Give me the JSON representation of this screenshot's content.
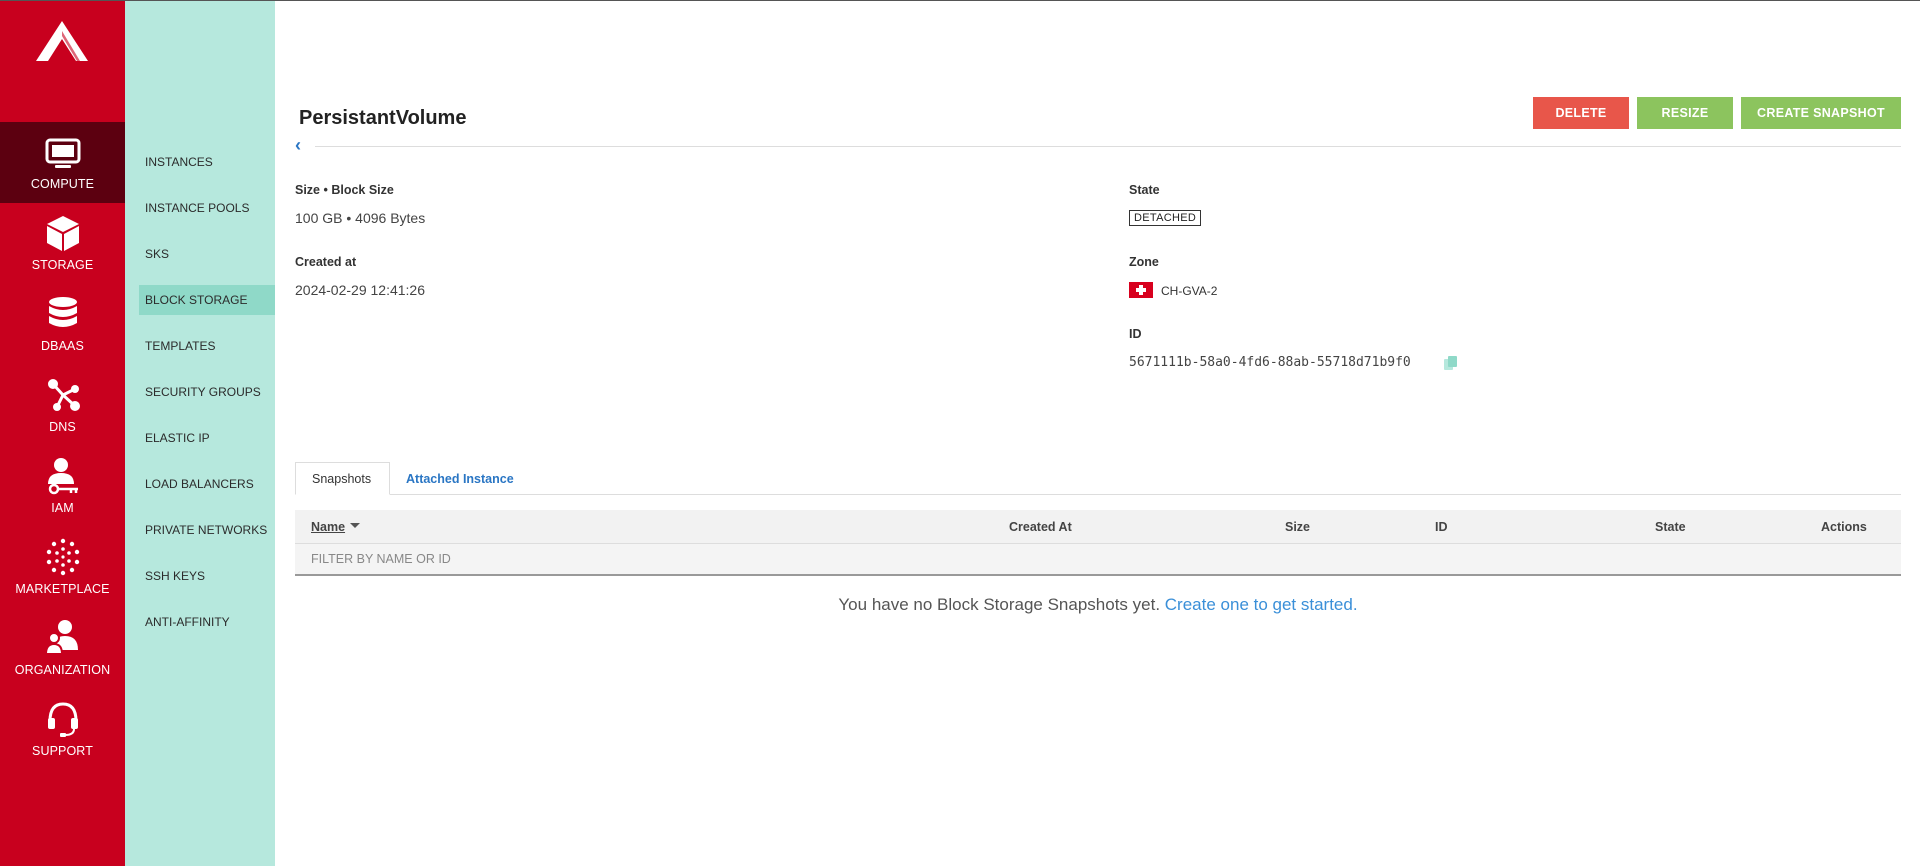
{
  "primary_nav": [
    {
      "label": "COMPUTE",
      "icon": "monitor-icon",
      "active": true
    },
    {
      "label": "STORAGE",
      "icon": "cube-icon",
      "active": false
    },
    {
      "label": "DBAAS",
      "icon": "database-icon",
      "active": false
    },
    {
      "label": "DNS",
      "icon": "dns-nodes-icon",
      "active": false
    },
    {
      "label": "IAM",
      "icon": "user-key-icon",
      "active": false
    },
    {
      "label": "MARKETPLACE",
      "icon": "marketplace-dots-icon",
      "active": false
    },
    {
      "label": "ORGANIZATION",
      "icon": "organization-icon",
      "active": false
    },
    {
      "label": "SUPPORT",
      "icon": "headset-icon",
      "active": false
    }
  ],
  "secondary_nav": [
    {
      "label": "INSTANCES",
      "active": false
    },
    {
      "label": "INSTANCE POOLS",
      "active": false
    },
    {
      "label": "SKS",
      "active": false
    },
    {
      "label": "BLOCK STORAGE",
      "active": true
    },
    {
      "label": "TEMPLATES",
      "active": false
    },
    {
      "label": "SECURITY GROUPS",
      "active": false
    },
    {
      "label": "ELASTIC IP",
      "active": false
    },
    {
      "label": "LOAD BALANCERS",
      "active": false
    },
    {
      "label": "PRIVATE NETWORKS",
      "active": false
    },
    {
      "label": "SSH KEYS",
      "active": false
    },
    {
      "label": "ANTI-AFFINITY",
      "active": false
    }
  ],
  "page": {
    "title": "PersistantVolume",
    "buttons": {
      "delete": "DELETE",
      "resize": "RESIZE",
      "create_snapshot": "CREATE SNAPSHOT"
    }
  },
  "details": {
    "size_label": "Size • Block Size",
    "size_value": "100 GB • 4096 Bytes",
    "created_label": "Created at",
    "created_value": "2024-02-29 12:41:26",
    "state_label": "State",
    "state_value": "DETACHED",
    "zone_label": "Zone",
    "zone_value": "CH-GVA-2",
    "id_label": "ID",
    "id_value": "5671111b-58a0-4fd6-88ab-55718d71b9f0"
  },
  "tabs": [
    {
      "label": "Snapshots",
      "active": true
    },
    {
      "label": "Attached Instance",
      "active": false
    }
  ],
  "table": {
    "columns": {
      "name": "Name",
      "created_at": "Created At",
      "size": "Size",
      "id": "ID",
      "state": "State",
      "actions": "Actions"
    },
    "filter_placeholder": "FILTER BY NAME OR ID",
    "empty_text": "You have no Block Storage Snapshots yet.",
    "empty_link": "Create one to get started",
    "empty_suffix": "."
  },
  "colors": {
    "primary_sidebar": "#c8001e",
    "primary_active": "#5c0010",
    "secondary_sidebar": "#b6e8dd",
    "secondary_active": "#8fd9c8",
    "delete": "#e8564a",
    "action_green": "#8cc45e",
    "link": "#2a76c4"
  }
}
